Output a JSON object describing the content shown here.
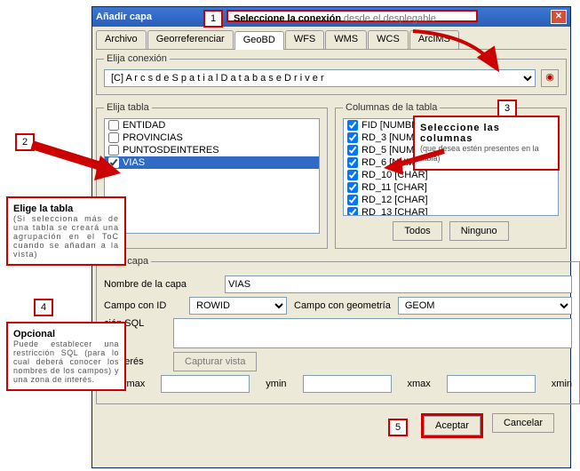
{
  "window": {
    "title": "Añadir capa"
  },
  "tabs": [
    "Archivo",
    "Georreferenciar",
    "GeoBD",
    "WFS",
    "WMS",
    "WCS",
    "ArcIMS"
  ],
  "conn": {
    "legend": "Elija conexión",
    "value": "[C]   A r c s d e  S p a t i a l  D a t a b a s e  D r i v e r"
  },
  "tables": {
    "legend": "Elija tabla",
    "items": [
      "ENTIDAD",
      "PROVINCIAS",
      "PUNTOSDEINTERES",
      "VIAS"
    ]
  },
  "cols": {
    "legend": "Columnas de la tabla",
    "items": [
      "FID [NUMBER]",
      "RD_3 [NUMBER]",
      "RD_5 [NUMBER]",
      "RD_6 [NUMBER]",
      "RD_10 [CHAR]",
      "RD_11 [CHAR]",
      "RD_12 [CHAR]",
      "RD_13 [CHAR]"
    ],
    "all": "Todos",
    "none": "Ninguno"
  },
  "opts": {
    "legend": "le la capa",
    "name_lbl": "Nombre de la capa",
    "name_val": "VIAS",
    "id_lbl": "Campo con ID",
    "id_val": "ROWID",
    "geom_lbl": "Campo con geometría",
    "geom_val": "GEOM",
    "sql_lbl": "ción SQL",
    "aoi_lbl": "le interés",
    "capture": "Capturar vista",
    "ymax": "ymax",
    "ymin": "ymin",
    "xmax": "xmax",
    "xmin": "xmin"
  },
  "buttons": {
    "ok": "Aceptar",
    "cancel": "Cancelar"
  },
  "callouts": {
    "c1": {
      "t": "Seleccione la conexión",
      "s": "desde el desplegable"
    },
    "c2": {
      "t": "Elige la tabla",
      "s": "(Si selecciona más de una tabla se creará una agrupación en el ToC cuando se añadan a la vista)"
    },
    "c3": {
      "t": "Seleccione las columnas",
      "s": "(que desea estén presentes en la tabla)"
    },
    "c4": {
      "t": "Opcional",
      "s": "Puede establecer una restricción SQL (para lo cual deberá conocer los nombres de los campos) y una zona de interés."
    }
  }
}
